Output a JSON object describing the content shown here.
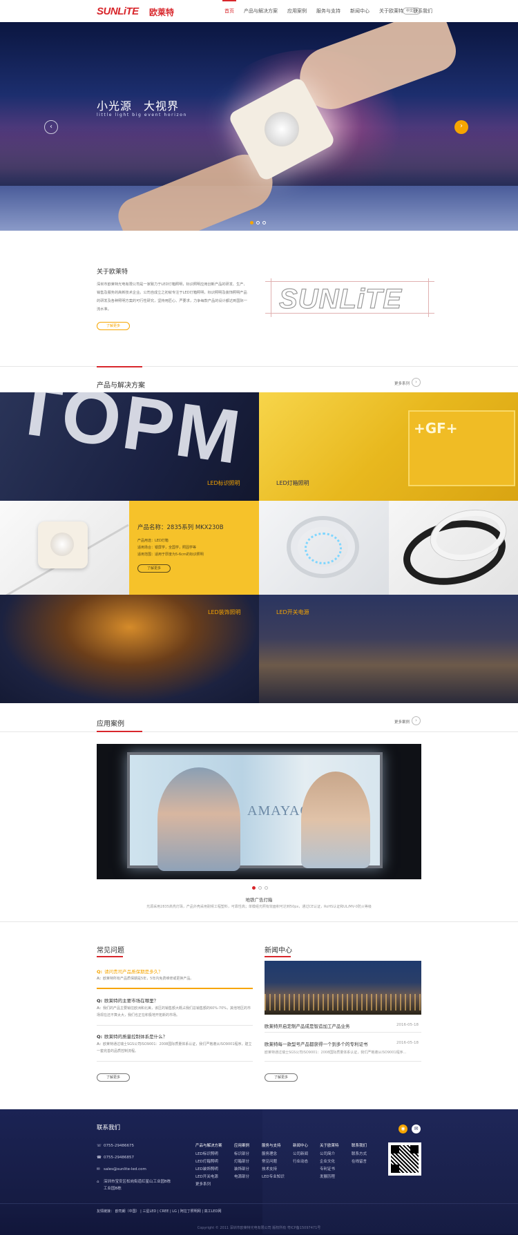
{
  "header": {
    "logo": "SUNLiTE",
    "logo_cn": "欧莱特",
    "nav": [
      "首页",
      "产品与解决方案",
      "应用案例",
      "服务与支持",
      "新闻中心",
      "关于欧莱特",
      "联系我们"
    ],
    "lang": "中文"
  },
  "banner": {
    "title": "小光源　大视界",
    "subtitle": "little light big event horizon",
    "prev": "‹",
    "next": "›"
  },
  "about": {
    "title": "关于欧莱特",
    "text": "深圳市欧莱特光电有限公司是一家致力于LED灯箱照明，标识照明应用创新产品的研发、生产、销售及服务的高新技术企业。公司自成立之初就专注于LED灯箱照明，标识照明及装饰照明产品的研发及各种照明方案的可行性研究，坚持用匠心、严要求，力争每款产品的设计都达到国际一流水准。",
    "button": "了解更多",
    "logo_word": "SUNLiTE"
  },
  "products": {
    "title": "产品与解决方案",
    "more": "更多系列",
    "tiles": [
      "LED标识照明",
      "LED灯箱照明",
      "LED装饰照明",
      "LED开关电源"
    ],
    "bigtext": "TOPM",
    "gf": "+GF+",
    "feature": {
      "name": "产品名称：2835系列 MKX230B",
      "lines": [
        "产品用途：LED灯箱",
        "适用场合：银屏学，全国学，照固学等",
        "适用范围：适用于厚度为5-6cm的标识照明"
      ],
      "button": "了解更多"
    }
  },
  "cases": {
    "title": "应用案例",
    "more": "更多案例",
    "brand": "AMAYAO",
    "caption": "地铁广告灯箱",
    "desc": "光源采用2835高亮灯珠，产品外壳采用耐候工程塑料，可靠性高；单模组光照有效面积可达到50px，通过CE认证，RoHS认证和UL/MV-0防火等级"
  },
  "faq": {
    "title": "常见问题",
    "items": [
      {
        "q": "请问贵司产品质保期是多久？",
        "a": "欧莱特所有产品质保期是5年，5年内免费维修或更换产品。"
      },
      {
        "q": "欧莱特的主要市场在哪里？",
        "a": "我们的产品主要销往欧洲和北美，该区的销售额大概占我们总销售额的60%-70%，其他地区的市场现在还不算太大，我们也正在积极地开拓新的市场。"
      },
      {
        "q": "欧莱特的质量控制体系是什么？",
        "a": "欧莱特通过瑞士SGS公司ISO9001：2008国际质量体系认证，我们严格遵从ISO9001程序，建立一套完善的品质控制流程。"
      }
    ],
    "button": "了解更多"
  },
  "news": {
    "title": "新闻中心",
    "items": [
      {
        "title": "欧莱特开启定制产品成是智造加工产品业务",
        "date": "2016-05-18"
      },
      {
        "title": "欧莱特每一款型号产品都获得一个到多个的专利证书",
        "date": "2016-05-18",
        "summary": "欧莱特通过瑞士SGS公司ISO9001：2008国际质量体系认证，我们严格遵从ISO9001程序..."
      }
    ],
    "button": "了解更多"
  },
  "footer": {
    "title": "联系我们",
    "contacts": [
      "0755-29486675",
      "0755-29486857",
      "sales@sunlite-led.com",
      "深圳市宝安区松岗街道红星山工业园B栋",
      "工业园B栋"
    ],
    "cols": [
      {
        "h": "产品与解决方案",
        "items": [
          "LED标识照明",
          "LED灯箱照明",
          "LED装饰照明",
          "LED开关电源",
          "更多系列"
        ]
      },
      {
        "h": "应用案例",
        "items": [
          "标识部分",
          "灯箱部分",
          "装饰部分",
          "电源部分"
        ]
      },
      {
        "h": "服务与支持",
        "items": [
          "服务理念",
          "常见问题",
          "技术支持",
          "LED专业知识"
        ]
      },
      {
        "h": "新闻中心",
        "items": [
          "公司新闻",
          "行业动态"
        ]
      },
      {
        "h": "关于欧莱特",
        "items": [
          "公司简介",
          "企业文化",
          "专利证书",
          "发展历程"
        ]
      },
      {
        "h": "联系我们",
        "items": [
          "联系方式",
          "在线留言"
        ]
      }
    ],
    "links": "友情链接：   欧司朗（中国）   |   三星LED   |   CREE   |   LG   |   阿拉丁照明网   |   高工LED网",
    "copyright": "Copyright © 2011 深圳市欧莱特光电有限公司 版权所有  粤ICP备15097471号"
  }
}
